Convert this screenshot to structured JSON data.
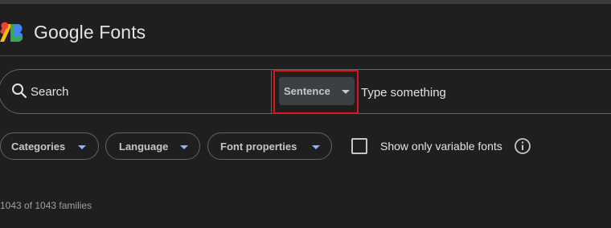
{
  "app": {
    "brand_name": "Google Fonts"
  },
  "search": {
    "label": "Search"
  },
  "preview": {
    "mode_selected": "Sentence",
    "input_placeholder": "Type something"
  },
  "filters": {
    "chips": [
      {
        "label": "Categories"
      },
      {
        "label": "Language"
      },
      {
        "label": "Font properties"
      }
    ],
    "variable_only_label": "Show only variable fonts",
    "variable_only_checked": false
  },
  "results": {
    "count_text": "1043 of 1043 families"
  },
  "colors": {
    "background": "#1f1f1f",
    "accent": "#8ab4f8",
    "highlight_box": "#e1141b"
  }
}
